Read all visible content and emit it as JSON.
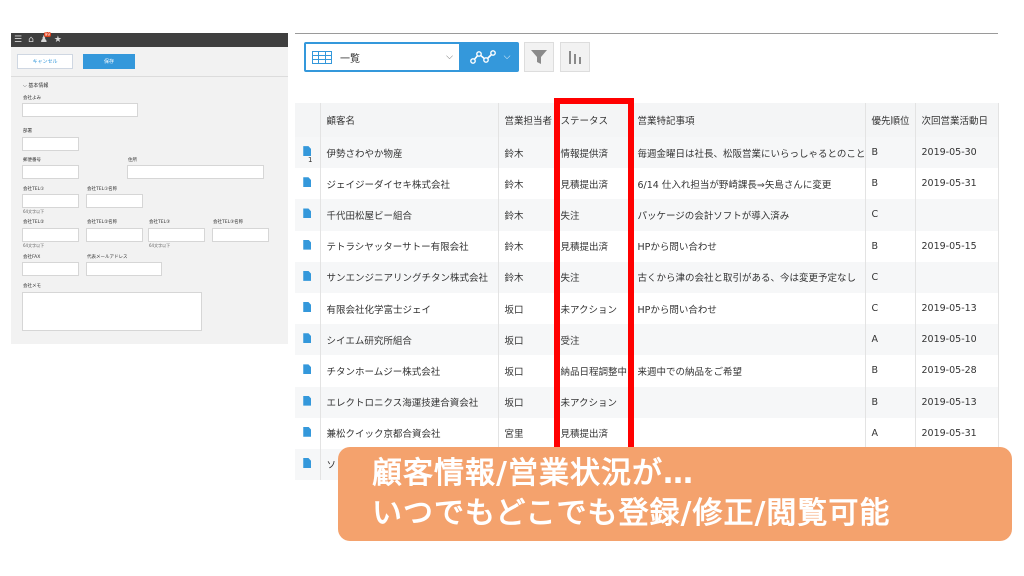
{
  "form": {
    "topbar_icons": [
      "menu-icon",
      "home-icon",
      "notification-icon",
      "star-icon"
    ],
    "notification_badge": "99",
    "cancel_label": "キャンセル",
    "save_label": "保存",
    "section_title": "基本情報",
    "labels": {
      "company_kana": "会社よみ",
      "department": "部署",
      "postal_code": "郵便番号",
      "address": "住所",
      "tel1": "会社TEL①",
      "tel1_name": "会社TEL①名称",
      "tel1_note": "64文字以下",
      "tel2": "会社TEL②",
      "tel2_name": "会社TEL②名称",
      "tel3": "会社TEL③",
      "tel3_name": "会社TEL③名称",
      "tel2_note": "64文字以下",
      "tel3_note": "64文字以下",
      "fax": "会社FAX",
      "email": "代表メールアドレス",
      "memo": "会社メモ"
    }
  },
  "toolbar": {
    "view_label": "一覧",
    "icons": [
      "list-view-icon",
      "graph-icon",
      "filter-icon",
      "bar-chart-icon"
    ]
  },
  "table": {
    "columns": [
      "",
      "顧客名",
      "営業担当者",
      "ステータス",
      "営業特記事項",
      "優先順位",
      "次回営業活動日"
    ],
    "rows": [
      {
        "num": "1",
        "name": "伊勢さわやか物産",
        "rep": "鈴木",
        "status": "情報提供済",
        "note": "毎週金曜日は社長、松阪営業にいらっしゃるとのこと",
        "priority": "B",
        "date": "2019-05-30"
      },
      {
        "num": "",
        "name": "ジェイジーダイセキ株式会社",
        "rep": "鈴木",
        "status": "見積提出済",
        "note": "6/14 仕入れ担当が野崎課長⇒矢島さんに変更",
        "priority": "B",
        "date": "2019-05-31"
      },
      {
        "num": "",
        "name": "千代田松屋ビー組合",
        "rep": "鈴木",
        "status": "失注",
        "note": "パッケージの会計ソフトが導入済み",
        "priority": "C",
        "date": ""
      },
      {
        "num": "",
        "name": "テトラシヤッターサトー有限会社",
        "rep": "鈴木",
        "status": "見積提出済",
        "note": "HPから問い合わせ",
        "priority": "B",
        "date": "2019-05-15"
      },
      {
        "num": "",
        "name": "サンエンジニアリングチタン株式会社",
        "rep": "鈴木",
        "status": "失注",
        "note": "古くから津の会社と取引がある、今は変更予定なし",
        "priority": "C",
        "date": ""
      },
      {
        "num": "",
        "name": "有限会社化学富士ジェイ",
        "rep": "坂口",
        "status": "未アクション",
        "note": "HPから問い合わせ",
        "priority": "C",
        "date": "2019-05-13"
      },
      {
        "num": "",
        "name": "シイエム研究所組合",
        "rep": "坂口",
        "status": "受注",
        "note": "",
        "priority": "A",
        "date": "2019-05-10"
      },
      {
        "num": "",
        "name": "チタンホームジー株式会社",
        "rep": "坂口",
        "status": "納品日程調整中",
        "note": "来週中での納品をご希望",
        "priority": "B",
        "date": "2019-05-28"
      },
      {
        "num": "",
        "name": "エレクトロニクス海運技建合資会社",
        "rep": "坂口",
        "status": "未アクション",
        "note": "",
        "priority": "B",
        "date": "2019-05-13"
      },
      {
        "num": "",
        "name": "兼松クイック京都合資会社",
        "rep": "宮里",
        "status": "見積提出済",
        "note": "",
        "priority": "A",
        "date": "2019-05-31"
      },
      {
        "num": "",
        "name": "ソ",
        "rep": "",
        "status": "",
        "note": "",
        "priority": "",
        "date": ""
      }
    ]
  },
  "callout": {
    "line1": "顧客情報/営業状況が…",
    "line2": "いつでもどこでも登録/修正/閲覧可能"
  },
  "colors": {
    "accent": "#3498db",
    "highlight": "#ff0000",
    "callout": "#f4a26d"
  }
}
